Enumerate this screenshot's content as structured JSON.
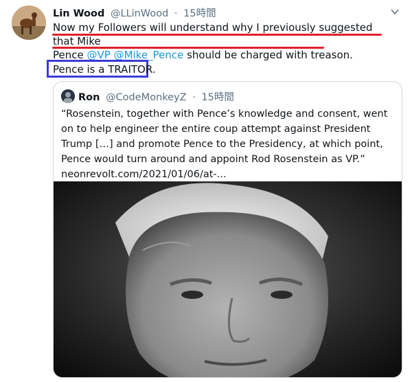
{
  "tweet": {
    "author_name": "Lin Wood",
    "author_handle": "@LLinWood",
    "separator": "·",
    "time": "15時間",
    "line1": "Now my Followers will understand why I previously suggested that Mike",
    "line2_pre": "Pence ",
    "mention_vp": "@VP",
    "mention_pence": "@Mike_Pence",
    "line2_post": " should be charged with treason.",
    "line3": "Pence is a TRAITOR."
  },
  "quote": {
    "author_name": "Ron",
    "author_handle": "@CodeMonkeyZ",
    "separator": "·",
    "time": "15時間",
    "text": "“Rosenstein, together with Pence’s knowledge and consent, went on to help engineer the entire coup attempt against President Trump […] and promote Pence to the Presidency, at which point, Pence would turn around and appoint Rod Rosenstein as VP.”",
    "link": "neonrevolt.com/2021/01/06/at-..."
  },
  "icons": {
    "caret": "chevron-down-icon"
  },
  "colors": {
    "mention": "#1b95e0",
    "underline": "#e0202b",
    "highlight_box": "#3b3bd9"
  }
}
